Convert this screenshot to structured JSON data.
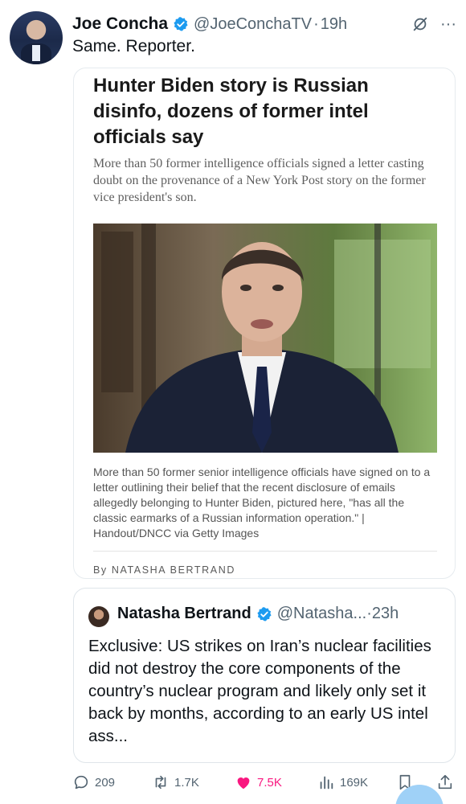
{
  "tweet": {
    "author_name": "Joe Concha",
    "author_handle": "@JoeConchaTV",
    "time": "19h",
    "text": "Same. Reporter."
  },
  "article": {
    "headline": "Hunter Biden story is Russian disinfo, dozens of former intel officials say",
    "subheadline": "More than 50 former intelligence officials signed a letter casting doubt on the provenance of a New York Post story on the former vice president's son.",
    "caption": "More than 50 former senior intelligence officials have signed on to a letter outlining their belief that the recent disclosure of emails allegedly belonging to Hunter Biden, pictured here, \"has all the classic earmarks of a Russian information operation.\" | Handout/DNCC via Getty Images",
    "byline": "By NATASHA BERTRAND"
  },
  "quote": {
    "author_name": "Natasha Bertrand",
    "author_handle": "@Natasha...",
    "time": "23h",
    "text": "Exclusive: US strikes on Iran’s nuclear facilities did not destroy the core components of the country’s nuclear program and likely only set it back by months, according to an early US intel ass..."
  },
  "actions": {
    "replies": "209",
    "reposts": "1.7K",
    "likes": "7.5K",
    "views": "169K"
  },
  "colors": {
    "verified": "#1d9bf0",
    "like": "#f91880",
    "secondary_text": "#536471"
  },
  "icons": [
    "verified-badge-icon",
    "grok-icon",
    "more-icon",
    "reply-icon",
    "repost-icon",
    "like-icon",
    "views-icon",
    "bookmark-icon",
    "share-icon"
  ]
}
